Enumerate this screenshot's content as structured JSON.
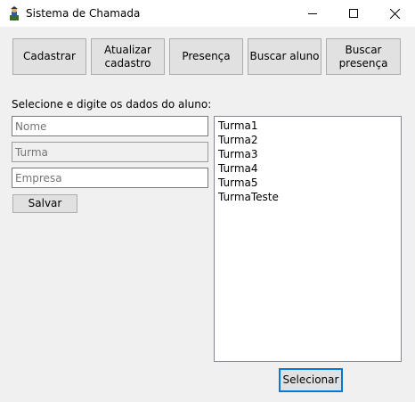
{
  "window": {
    "title": "Sistema de Chamada",
    "icon": "app-icon"
  },
  "toolbar": {
    "cadastrar": "Cadastrar",
    "atualizar": "Atualizar\ncadastro",
    "presenca": "Presença",
    "buscar_aluno": "Buscar aluno",
    "buscar_presenca": "Buscar\npresença"
  },
  "form": {
    "instruction": "Selecione e digite os dados do aluno:",
    "nome_placeholder": "Nome",
    "turma_placeholder": "Turma",
    "empresa_placeholder": "Empresa",
    "salvar": "Salvar"
  },
  "turmas": {
    "items": [
      "Turma1",
      "Turma2",
      "Turma3",
      "Turma4",
      "Turma5",
      "TurmaTeste"
    ],
    "selecionar": "Selecionar"
  }
}
